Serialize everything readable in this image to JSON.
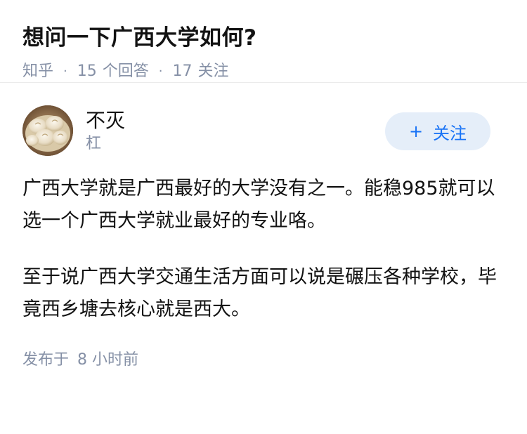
{
  "question": {
    "title": "想问一下广西大学如何?",
    "source": "知乎",
    "answer_count": "15",
    "answer_label": "个回答",
    "follow_count": "17",
    "follow_label": "关注"
  },
  "answer": {
    "author": {
      "name": "不灭",
      "headline": "杠",
      "avatar_icon": "food-avatar-icon"
    },
    "follow_button": {
      "plus": "+",
      "label": "关注"
    },
    "paragraphs": [
      "广西大学就是广西最好的大学没有之一。能稳985就可以选一个广西大学就业最好的专业咯。",
      "至于说广西大学交通生活方面可以说是碾压各种学校，毕竟西乡塘去核心就是西大。"
    ],
    "time_prefix": "发布于",
    "time_value": "8 小时前"
  },
  "colors": {
    "text": "#121212",
    "meta": "#8590a6",
    "accent": "#1772f6",
    "button_bg": "#e5eef9"
  }
}
